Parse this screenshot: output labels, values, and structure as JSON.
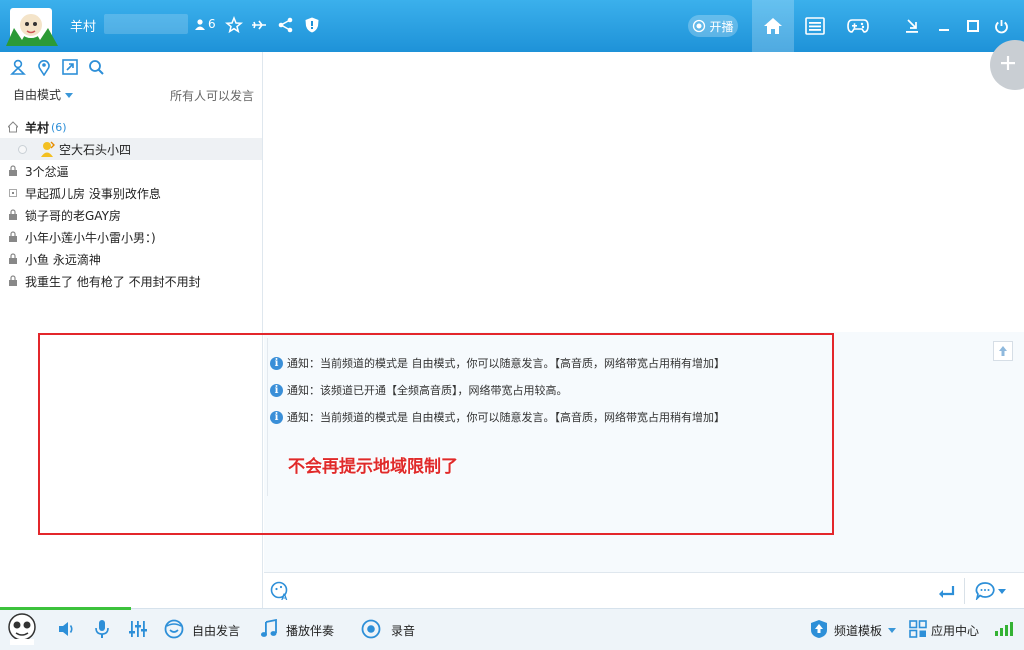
{
  "header": {
    "group_name": "羊村",
    "member_count": "6",
    "broadcast_label": "开播"
  },
  "left_panel": {
    "mode_label": "自由模式",
    "permission_text": "所有人可以发言",
    "root_channel": {
      "name": "羊村",
      "count": "(6)"
    },
    "current_user": "空大石头小四",
    "channels": [
      "3个忿逼",
      "早起孤儿房 没事别改作息",
      "锁子哥的老GAY房",
      "小年小莲小牛小雷小男：)",
      "小鱼 永远滴神",
      "我重生了 他有枪了 不用封不用封"
    ]
  },
  "messages": [
    "通知：当前频道的模式是 自由模式，你可以随意发言。【高音质，网络带宽占用稍有增加】",
    "通知：该频道已开通【全频高音质】，网络带宽占用较高。",
    "通知：当前频道的模式是 自由模式，你可以随意发言。【高音质，网络带宽占用稍有增加】"
  ],
  "annotation": "不会再提示地域限制了",
  "bottom_bar": {
    "free_speak_label": "自由发言",
    "accompaniment_label": "播放伴奏",
    "record_label": "录音",
    "channel_template_label": "频道模板",
    "app_center_label": "应用中心"
  },
  "colors": {
    "title_bar": "#1e92d8",
    "accent": "#3a97d8",
    "annotation_red": "#e02a2a",
    "highlight_box": "#e3262b",
    "signal_green": "#34b234"
  }
}
